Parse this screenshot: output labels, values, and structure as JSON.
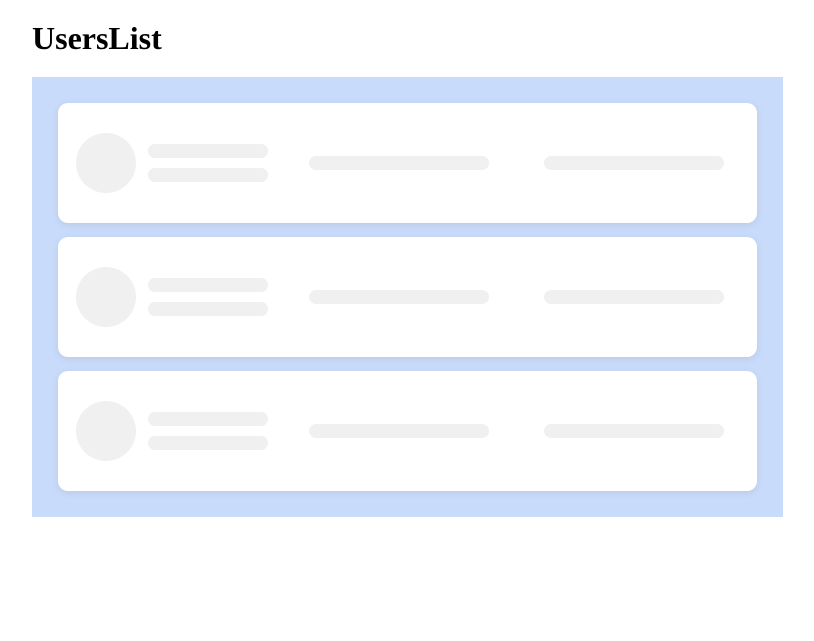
{
  "page": {
    "title": "UsersList"
  },
  "skeleton": {
    "cards_count": 3
  }
}
